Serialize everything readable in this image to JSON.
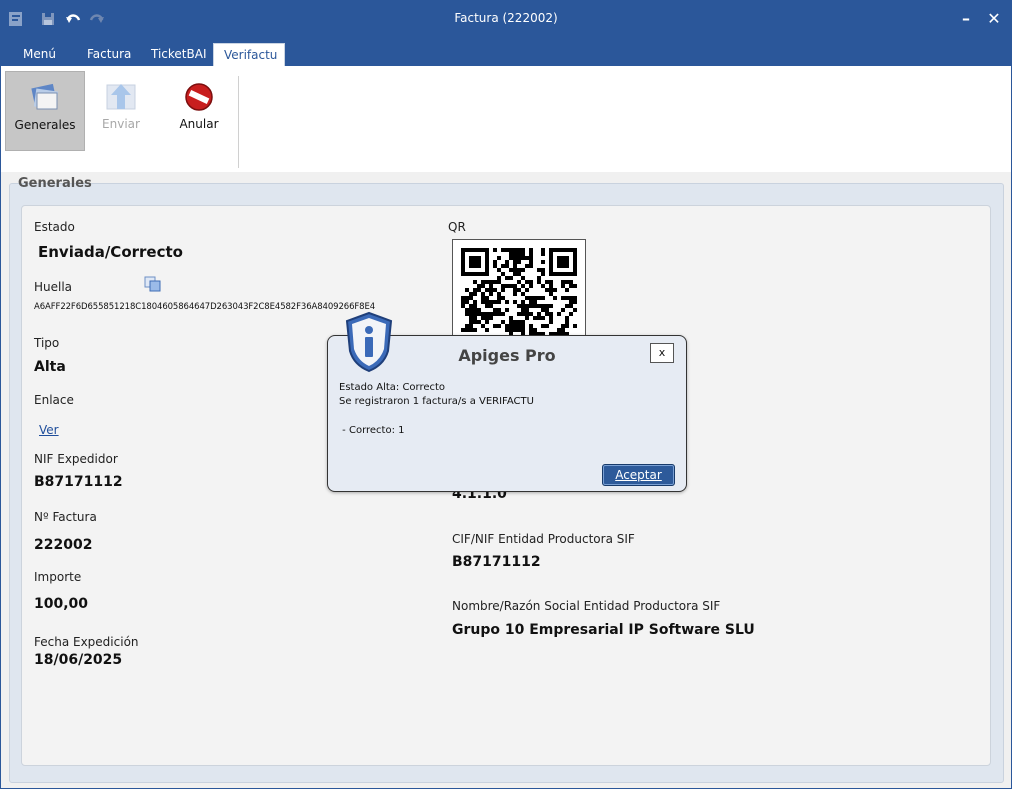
{
  "window": {
    "title": "Factura (222002)",
    "minimize_label": "–",
    "close_label": "✕"
  },
  "tabs": [
    {
      "label": "Menú"
    },
    {
      "label": "Factura"
    },
    {
      "label": "TicketBAI"
    },
    {
      "label": "Verifactu"
    }
  ],
  "ribbon": {
    "generales_label": "Generales",
    "enviar_label": "Enviar",
    "anular_label": "Anular"
  },
  "panel": {
    "group_title": "Generales",
    "estado_label": "Estado",
    "estado_value": "Enviada/Correcto",
    "huella_label": "Huella",
    "huella_value": "A6AFF22F6D655851218C1804605864647D263043F2C8E4582F36A8409266F8E4",
    "tipo_label": "Tipo",
    "tipo_value": "Alta",
    "enlace_label": "Enlace",
    "enlace_link": "Ver",
    "nif_label": "NIF Expedidor",
    "nif_value": "B87171112",
    "numero_label": "Nº Factura",
    "numero_value": "222002",
    "importe_label": "Importe",
    "importe_value": "100,00",
    "fecha_label": "Fecha Expedición",
    "fecha_value": "18/06/2025",
    "qr_label": "QR",
    "version_value": "4.1.1.0",
    "cif_label": "CIF/NIF Entidad Productora SIF",
    "cif_value": "B87171112",
    "nombre_label": "Nombre/Razón Social Entidad Productora SIF",
    "nombre_value": "Grupo 10 Empresarial IP Software SLU"
  },
  "dialog": {
    "title": "Apiges Pro",
    "close_label": "x",
    "line1": "Estado Alta: Correcto",
    "line2": "Se registraron 1 factura/s a VERIFACTU",
    "line3": " - Correcto: 1",
    "ok_label": "Aceptar"
  },
  "colors": {
    "accent": "#2b579a",
    "button": "#2d5a9a"
  }
}
